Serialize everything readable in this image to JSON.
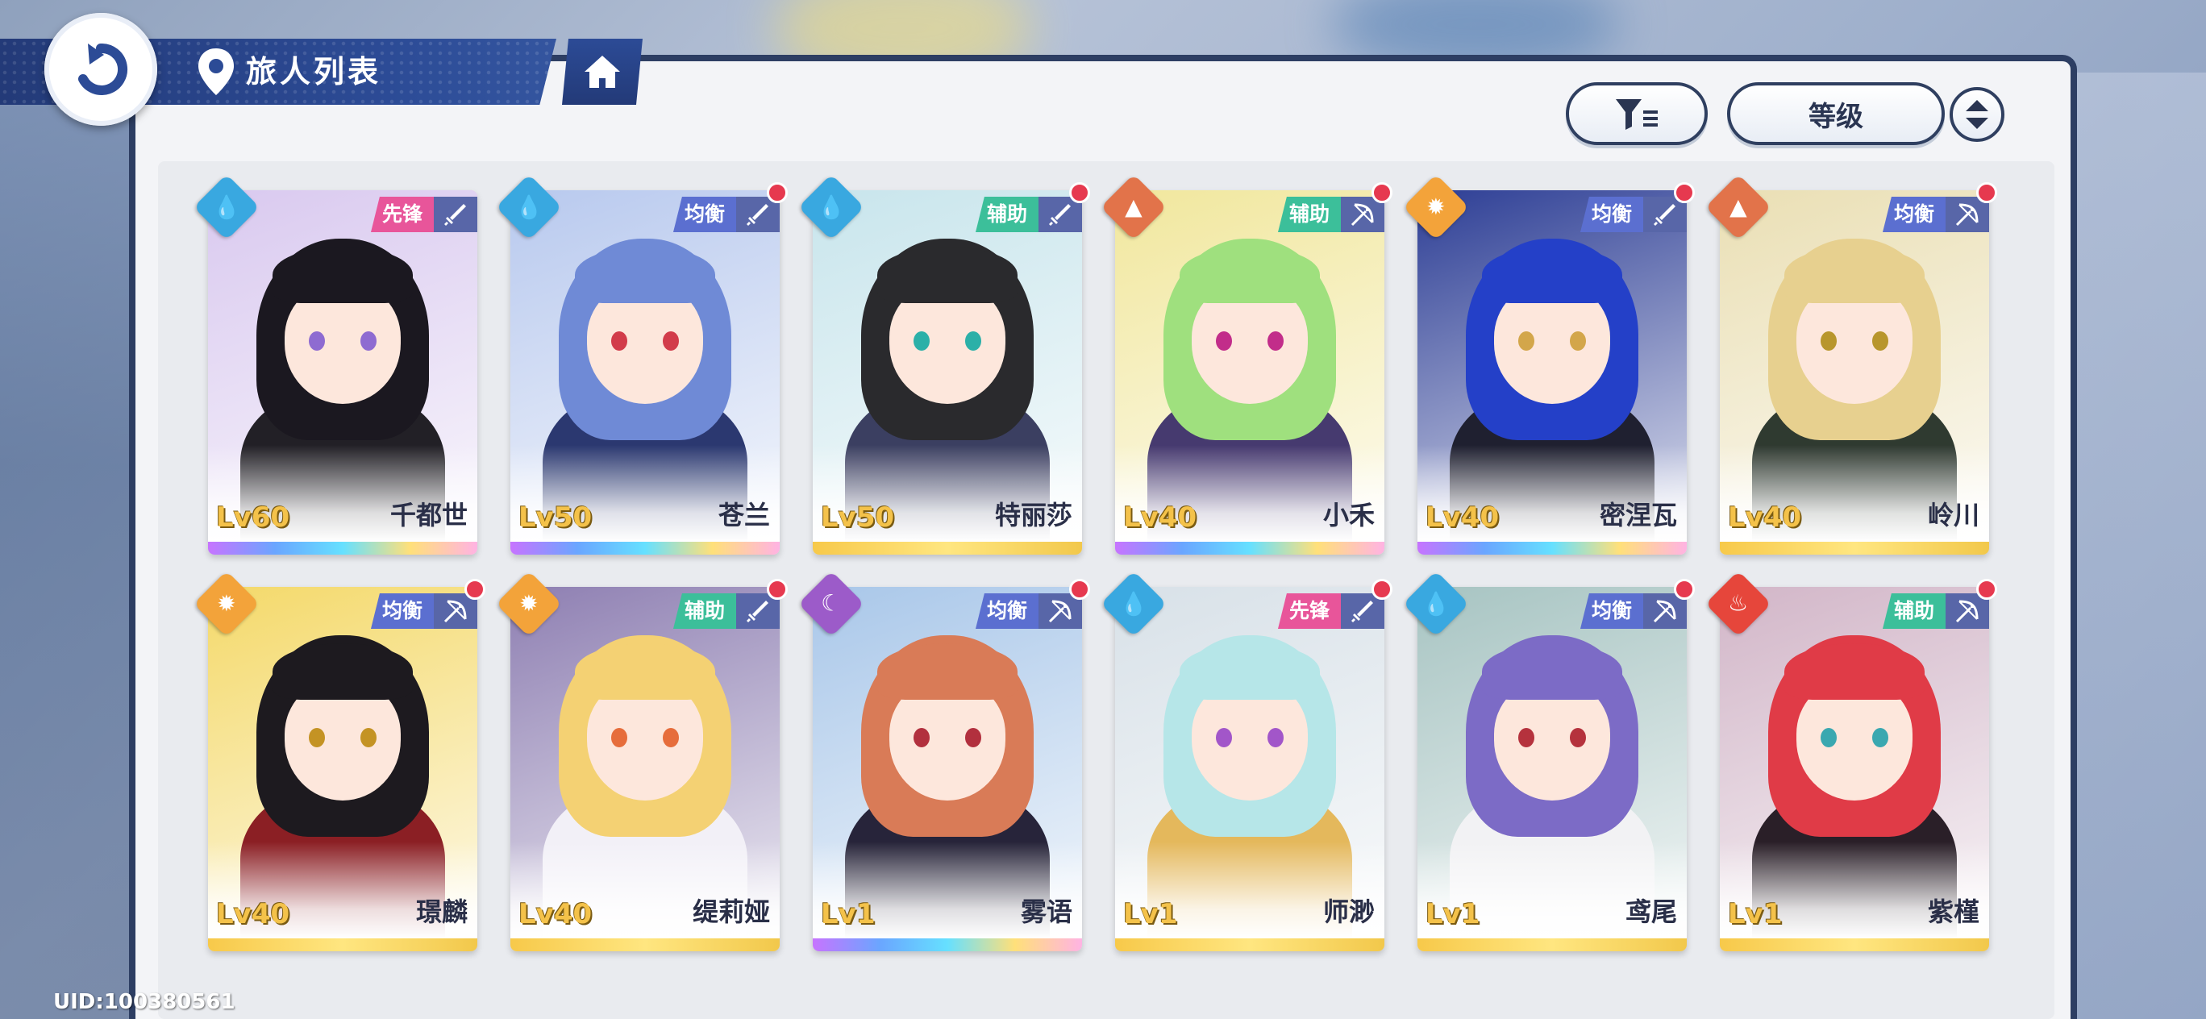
{
  "header": {
    "title": "旅人列表"
  },
  "toolbar": {
    "sort_label": "等级"
  },
  "uid": "UID:100380561",
  "colors": {
    "header_blue": "#233a78",
    "support_green": "#3cbf9a",
    "balance_blue": "#5b6fd0",
    "vanguard_pink": "#e8559a",
    "notify_red": "#e6394f",
    "level_gold": "#f4c24a"
  },
  "characters": [
    {
      "name": "千都世",
      "level": "Lv60",
      "role": "先锋",
      "element": "water-icon",
      "weapon": "sword-icon",
      "frame": "rainbow",
      "notify": false
    },
    {
      "name": "苍兰",
      "level": "Lv50",
      "role": "均衡",
      "element": "water-icon",
      "weapon": "sword-icon",
      "frame": "rainbow",
      "notify": true
    },
    {
      "name": "特丽莎",
      "level": "Lv50",
      "role": "辅助",
      "element": "water-icon",
      "weapon": "sword-icon",
      "frame": "gold",
      "notify": true
    },
    {
      "name": "小禾",
      "level": "Lv40",
      "role": "辅助",
      "element": "mountain-icon",
      "weapon": "bow-icon",
      "frame": "rainbow",
      "notify": true
    },
    {
      "name": "密涅瓦",
      "level": "Lv40",
      "role": "均衡",
      "element": "sun-icon",
      "weapon": "sword-icon",
      "frame": "rainbow",
      "notify": true
    },
    {
      "name": "岭川",
      "level": "Lv40",
      "role": "均衡",
      "element": "mountain-icon",
      "weapon": "bow-icon",
      "frame": "gold",
      "notify": true
    },
    {
      "name": "璟麟",
      "level": "Lv40",
      "role": "均衡",
      "element": "sun-icon",
      "weapon": "bow-icon",
      "frame": "gold",
      "notify": true
    },
    {
      "name": "缇莉娅",
      "level": "Lv40",
      "role": "辅助",
      "element": "sun-icon",
      "weapon": "sword-icon",
      "frame": "gold",
      "notify": true
    },
    {
      "name": "雾语",
      "level": "Lv1",
      "role": "均衡",
      "element": "moon-icon",
      "weapon": "bow-icon",
      "frame": "rainbow",
      "notify": true
    },
    {
      "name": "师渺",
      "level": "Lv1",
      "role": "先锋",
      "element": "water-icon",
      "weapon": "sword-icon",
      "frame": "gold",
      "notify": true
    },
    {
      "name": "鸢尾",
      "level": "Lv1",
      "role": "均衡",
      "element": "water-icon",
      "weapon": "bow-icon",
      "frame": "gold",
      "notify": true
    },
    {
      "name": "紫槿",
      "level": "Lv1",
      "role": "辅助",
      "element": "fire-icon",
      "weapon": "bow-icon",
      "frame": "gold",
      "notify": true
    }
  ]
}
